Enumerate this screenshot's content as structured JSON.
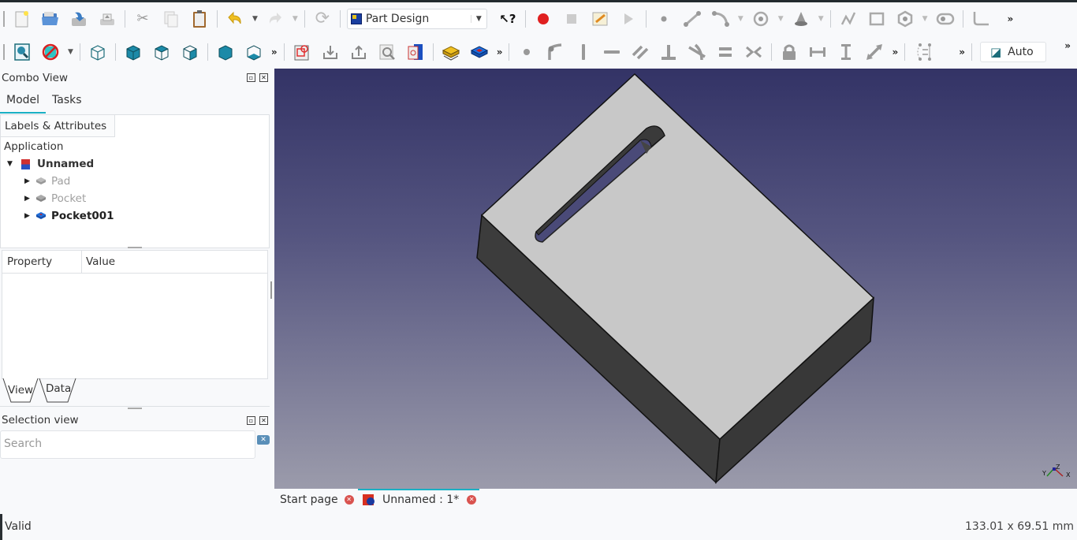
{
  "toolbar1": {
    "workbench": "Part Design",
    "icons": [
      "new-document",
      "open-file",
      "save",
      "print",
      "cut",
      "copy",
      "paste",
      "undo",
      "redo",
      "refresh",
      "whats-this",
      "record-macro",
      "stop-macro",
      "edit-macro",
      "run-macro",
      "sketch-point",
      "sketch-line",
      "sketch-arc",
      "sketch-circle",
      "sketch-conic",
      "sketch-polyline",
      "sketch-rectangle",
      "sketch-polygon",
      "sketch-slot",
      "sketch-fillet"
    ]
  },
  "toolbar2": {
    "icons": [
      "fit-all",
      "draw-style",
      "view-isometric",
      "view-front",
      "view-top",
      "view-right",
      "view-rear",
      "view-bottom",
      "create-body",
      "export",
      "import",
      "measure",
      "part",
      "pad",
      "pocket",
      "constraint-point",
      "constraint-tangent",
      "constraint-vertical",
      "constraint-horizontal",
      "constraint-parallel",
      "constraint-perpendicular",
      "constraint-tangent-curve",
      "constraint-equal",
      "constraint-symmetric",
      "constraint-lock",
      "constraint-horizontal-distance",
      "constraint-vertical-distance",
      "constraint-distance",
      "toggle-constraints"
    ],
    "auto_label": "Auto"
  },
  "combo_view": {
    "title": "Combo View",
    "tabs": [
      "Model",
      "Tasks"
    ],
    "active_tab": "Model",
    "tree_header": "Labels & Attributes",
    "root_label": "Application",
    "document": "Unnamed",
    "features": [
      {
        "label": "Pad",
        "visible": false
      },
      {
        "label": "Pocket",
        "visible": false
      },
      {
        "label": "Pocket001",
        "visible": true
      }
    ],
    "property_columns": [
      "Property",
      "Value"
    ],
    "bottom_tabs": [
      "View",
      "Data"
    ]
  },
  "selection_view": {
    "title": "Selection view",
    "search_placeholder": "Search"
  },
  "document_tabs": [
    {
      "label": "Start page",
      "active": false
    },
    {
      "label": "Unnamed : 1*",
      "active": true
    }
  ],
  "status_bar": {
    "message": "Valid",
    "dimensions": "133.01 x 69.51 mm"
  },
  "axis_labels": {
    "x": "X",
    "y": "Y",
    "z": "Z"
  },
  "colors": {
    "accent": "#1ab0c4",
    "record": "#e02020",
    "close": "#d9534f"
  }
}
